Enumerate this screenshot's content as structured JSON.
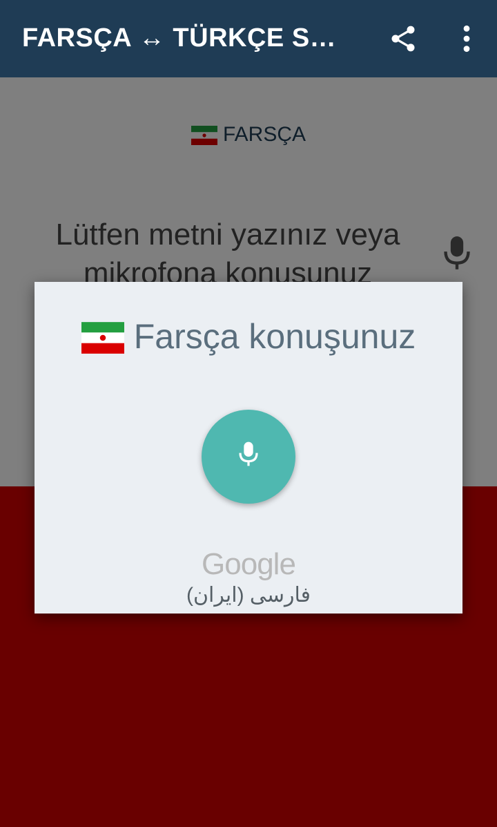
{
  "app_bar": {
    "title": "FARSÇA ↔ TÜRKÇE SES…",
    "share_icon": "share-icon",
    "menu_icon": "more-vert-icon",
    "background": "#1f3c55"
  },
  "source": {
    "language_label": "FARSÇA",
    "flag_icon": "iran-flag-icon",
    "placeholder": "Lütfen metni yazınız veya mikrofona konuşunuz",
    "mic_icon": "microphone-icon"
  },
  "target_panel": {
    "background": "#d20000"
  },
  "speech_dialog": {
    "prompt": "Farsça konuşunuz",
    "flag_icon": "iran-flag-icon",
    "mic_button_color": "#4fb8b0",
    "provider": "Google",
    "locale": "فارسی (ایران)"
  }
}
